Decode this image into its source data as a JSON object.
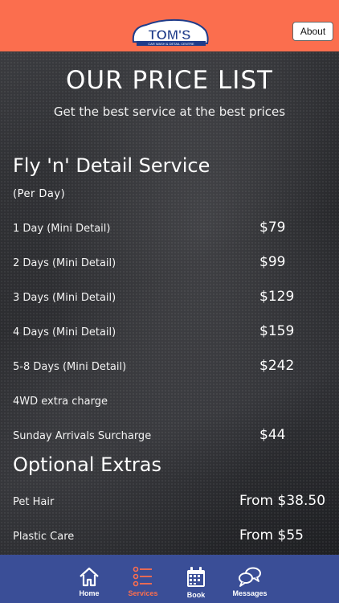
{
  "header": {
    "logo_text": "TOM'S",
    "logo_tagline": "CAR WASH & DETAIL CENTRE",
    "about_label": "About"
  },
  "main": {
    "title": "OUR PRICE LIST",
    "subtitle": "Get the best service at the best prices",
    "sections": [
      {
        "title": "Fly 'n' Detail Service",
        "note": "(Per Day)",
        "rows": [
          {
            "label": "1 Day (Mini Detail)",
            "price": "$79"
          },
          {
            "label": "2 Days (Mini Detail)",
            "price": "$99"
          },
          {
            "label": "3 Days (Mini Detail)",
            "price": "$129"
          },
          {
            "label": "4 Days (Mini Detail)",
            "price": "$159"
          },
          {
            "label": "5-8 Days (Mini Detail)",
            "price": "$242"
          },
          {
            "label": "4WD extra charge",
            "price": ""
          },
          {
            "label": "Sunday Arrivals Surcharge",
            "price": "$44"
          }
        ]
      },
      {
        "title": "Optional Extras",
        "rows": [
          {
            "label": "Pet Hair",
            "price": "From $38.50"
          },
          {
            "label": "Plastic Care",
            "price": "From $55"
          }
        ]
      }
    ]
  },
  "tabbar": {
    "tabs": [
      {
        "label": "Home",
        "icon": "home-icon",
        "active": false
      },
      {
        "label": "Services",
        "icon": "list-icon",
        "active": true
      },
      {
        "label": "Book",
        "icon": "calendar-icon",
        "active": false
      },
      {
        "label": "Messages",
        "icon": "chat-bubbles-icon",
        "active": false
      }
    ]
  },
  "colors": {
    "header_bg": "#fb6e4e",
    "tabbar_bg": "#3a4e97",
    "active_tab": "#fb6e4e",
    "logo_blue": "#1f3c8a"
  }
}
